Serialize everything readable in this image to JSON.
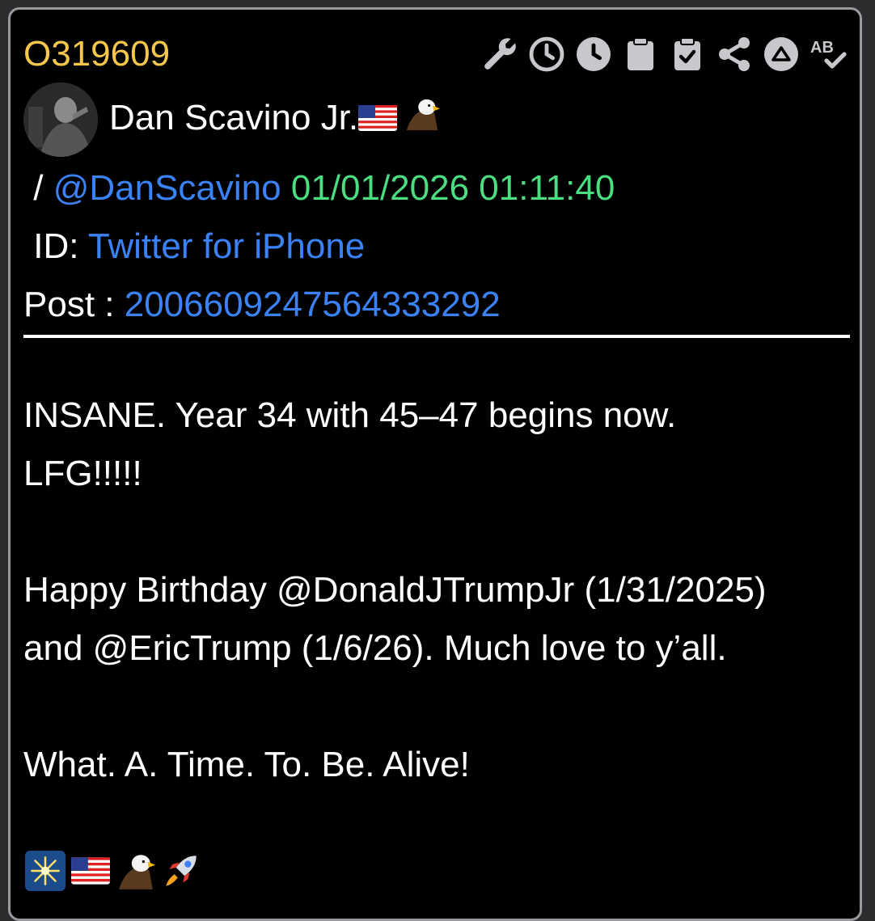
{
  "post": {
    "id": "O319609",
    "author_name": "Dan Scavino Jr.",
    "handle_prefix": " / ",
    "handle": "@DanScavino",
    "timestamp": "01/01/2026 01:11:40",
    "id_label": " ID: ",
    "source": "Twitter for iPhone",
    "post_label": "Post : ",
    "post_number": "2006609247564333292"
  },
  "body": {
    "line1": "INSANE. Year 34 with 45–47 begins now.",
    "line2": "LFG!!!!!",
    "line3": "Happy Birthday @DonaldJTrumpJr (1/31/2025)",
    "line4": "and @EricTrump (1/6/26). Much love to y’all.",
    "line5": "What. A. Time. To. Be. Alive!"
  },
  "toolbar": {
    "icons": [
      "wrench-icon",
      "clock-outline-icon",
      "clock-filled-icon",
      "clipboard-icon",
      "clipboard-check-icon",
      "share-icon",
      "arrow-up-circle-icon",
      "spellcheck-icon"
    ]
  },
  "emojis": [
    "sparkler-emoji",
    "us-flag-emoji",
    "eagle-emoji",
    "rocket-emoji"
  ],
  "colors": {
    "post_id": "#f5c84c",
    "link": "#3b82f6",
    "timestamp": "#4ade80",
    "icon": "#c7c7cc",
    "background": "#000000",
    "border": "#9a9a9e"
  }
}
